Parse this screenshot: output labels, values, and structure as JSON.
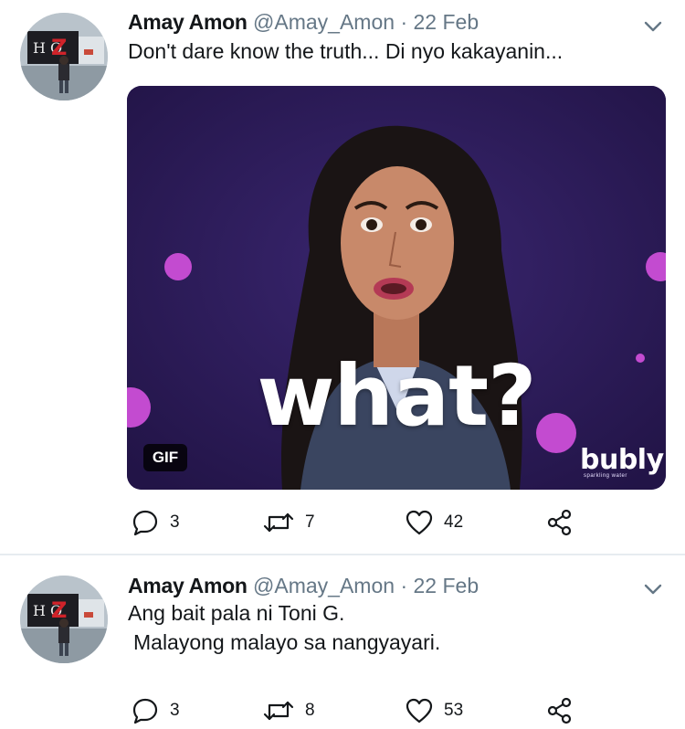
{
  "tweets": [
    {
      "name": "Amay Amon",
      "handle": "@Amay_Amon",
      "separator": "·",
      "date": "22 Feb",
      "text_lines": [
        "Don't dare know the truth... Di nyo kakayanin..."
      ],
      "media": {
        "badge": "GIF",
        "caption": "what?",
        "brand": "bubly",
        "brand_sub": "sparkling water"
      },
      "counts": {
        "replies": "3",
        "retweets": "7",
        "likes": "42"
      }
    },
    {
      "name": "Amay Amon",
      "handle": "@Amay_Amon",
      "separator": "·",
      "date": "22 Feb",
      "text_lines": [
        "Ang bait pala ni Toni G.",
        "Malayong malayo sa nangyayari."
      ],
      "counts": {
        "replies": "3",
        "retweets": "8",
        "likes": "53"
      }
    }
  ],
  "icons": {
    "reply": "reply-icon",
    "retweet": "retweet-icon",
    "like": "heart-icon",
    "share": "share-icon",
    "menu": "chevron-down-icon"
  },
  "colors": {
    "secondary_text": "#657786",
    "divider": "#e6ecf0",
    "media_bg": "#2a1a55",
    "accent_dots": "#c34bd0"
  }
}
